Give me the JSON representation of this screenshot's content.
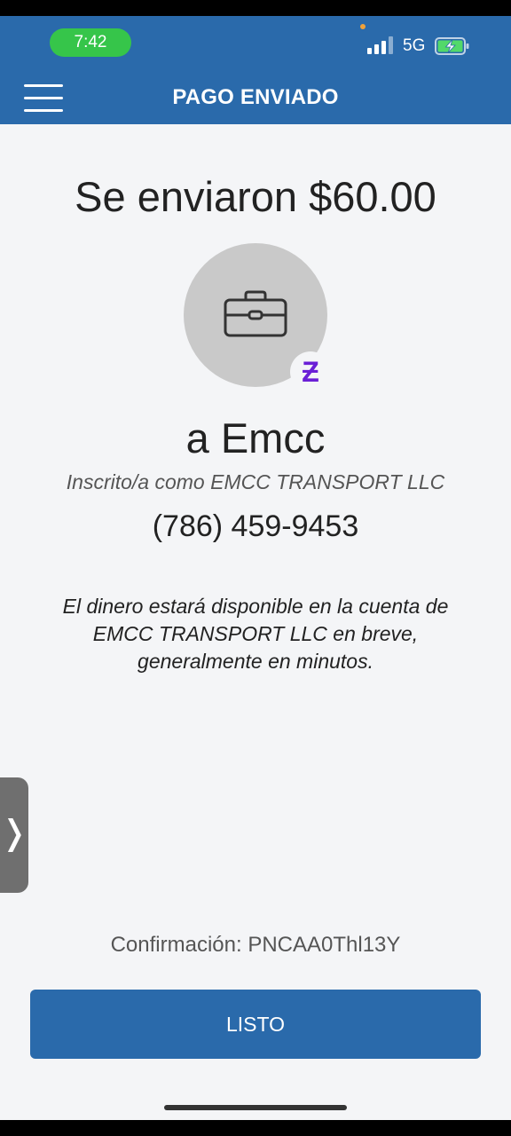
{
  "status_bar": {
    "time": "7:42",
    "network": "5G",
    "signal_bars_active": 3,
    "battery": "charging"
  },
  "header": {
    "title": "PAGO ENVIADO",
    "menu_icon": "hamburger-menu-icon",
    "background_color": "#2a6aab"
  },
  "payment": {
    "amount_text": "Se enviaron $60.00",
    "recipient_icon": "briefcase-icon",
    "badge_icon": "zelle-z-icon",
    "badge_text": "Ƶ",
    "recipient_name": "a Emcc",
    "enrolled_as": "Inscrito/a como EMCC TRANSPORT LLC",
    "phone": "(786) 459-9453",
    "note": "El dinero estará disponible en la cuenta de EMCC TRANSPORT LLC en breve, generalmente en minutos."
  },
  "side_tab": {
    "icon": "chevron-right-icon",
    "glyph": "❭"
  },
  "confirmation": "Confirmación: PNCAA0Thl13Y",
  "done_button": {
    "label": "LISTO"
  },
  "colors": {
    "accent": "#2a6aab",
    "zelle": "#6a1fd6",
    "time_pill": "#36c54a",
    "background": "#f4f5f7"
  }
}
